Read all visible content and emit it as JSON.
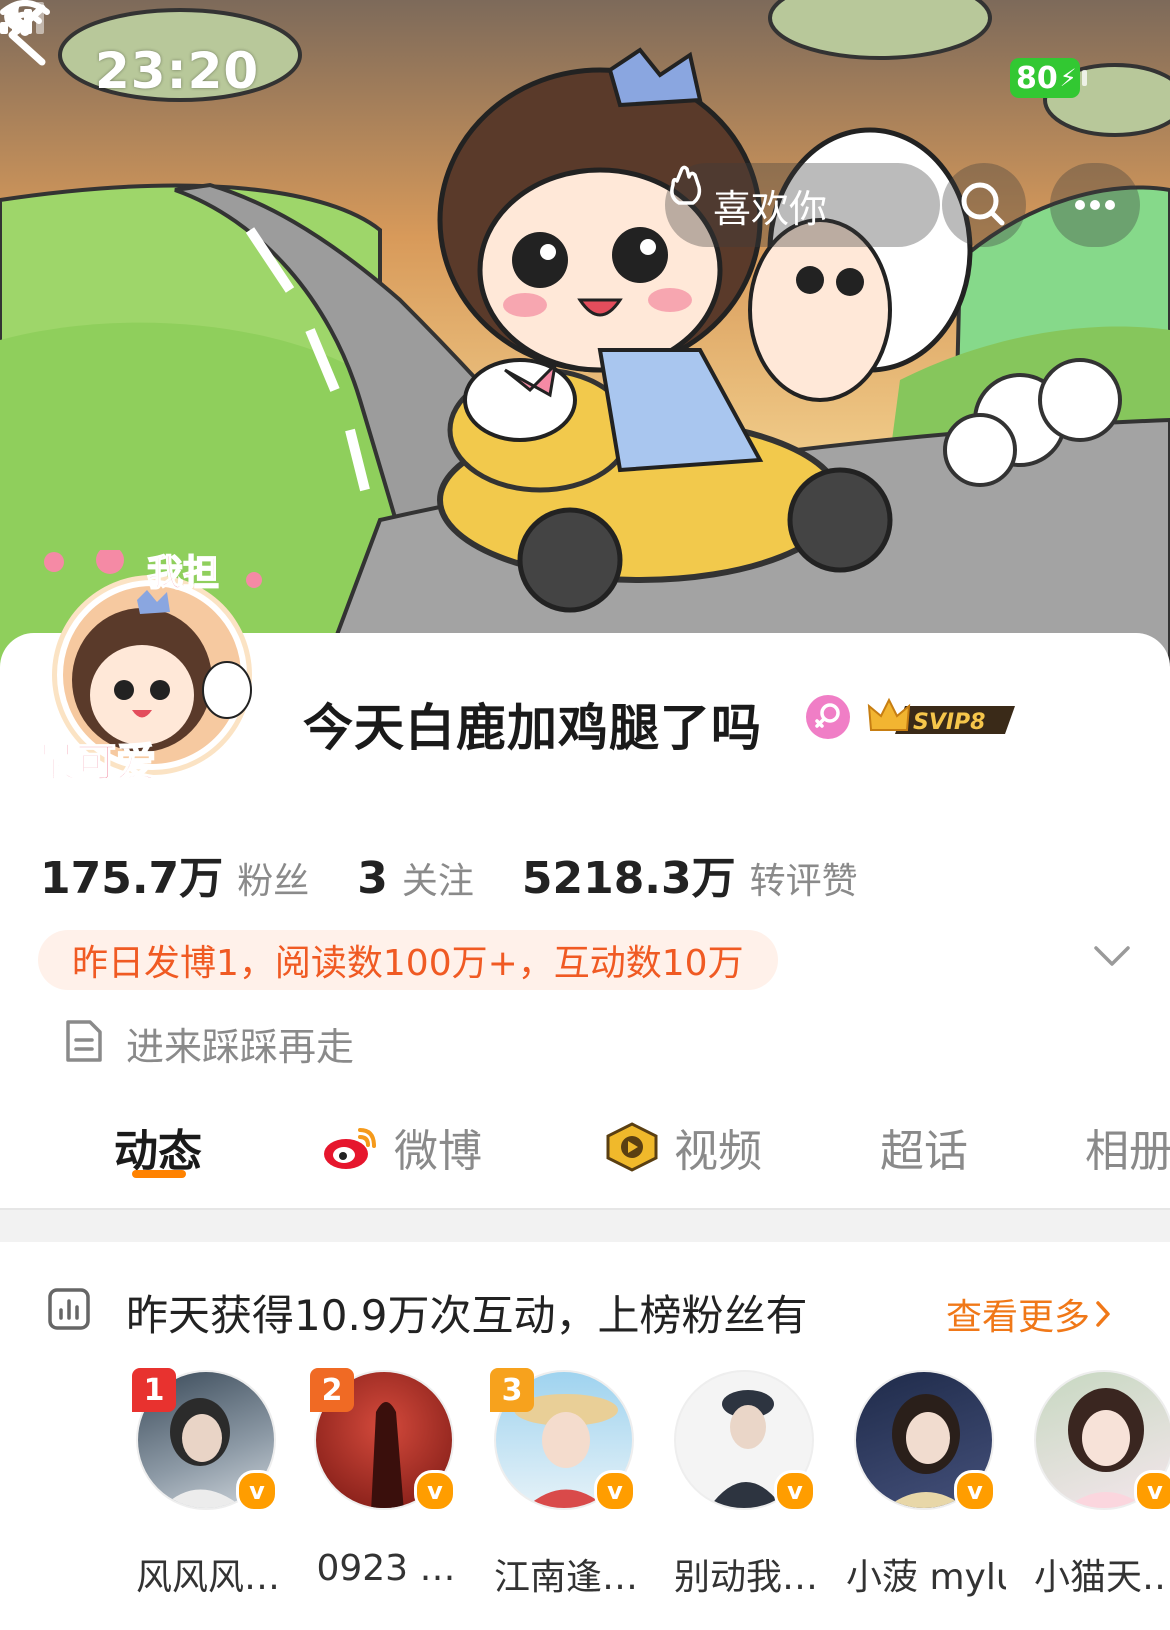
{
  "status_bar": {
    "time": "23:20",
    "battery": "80"
  },
  "header": {
    "like_label": "喜欢你"
  },
  "profile": {
    "name": "今天白鹿加鸡腿了吗",
    "vip_level": "SVIP8",
    "avatar_text_top": "我担",
    "avatar_text_bottom": "最可爱"
  },
  "stats": [
    {
      "value": "175.7万",
      "label": "粉丝"
    },
    {
      "value": "3",
      "label": "关注"
    },
    {
      "value": "5218.3万",
      "label": "转评赞"
    }
  ],
  "activity": "昨日发博1，阅读数100万+，互动数10万",
  "bio": "进来踩踩再走",
  "tabs": [
    {
      "label": "动态",
      "active": true
    },
    {
      "label": "微博",
      "icon": "weibo-icon"
    },
    {
      "label": "视频",
      "icon": "video-icon"
    },
    {
      "label": "超话"
    },
    {
      "label": "相册"
    }
  ],
  "ranking": {
    "title": "昨天获得10.9万次互动，上榜粉丝有",
    "more": "查看更多",
    "fans": [
      {
        "rank": "1",
        "name": "风风风…"
      },
      {
        "rank": "2",
        "name": "0923 …"
      },
      {
        "rank": "3",
        "name": "江南逢…"
      },
      {
        "rank": "",
        "name": "别动我…"
      },
      {
        "rank": "",
        "name": "小菠 mylu"
      },
      {
        "rank": "",
        "name": "小猫天…"
      }
    ]
  },
  "colors": {
    "accent": "#ff8200",
    "activity_text": "#f05a23",
    "rank1": "#e8322f",
    "rank2": "#f06a24",
    "rank3": "#f7a21d",
    "verified": "#ff9d00"
  }
}
